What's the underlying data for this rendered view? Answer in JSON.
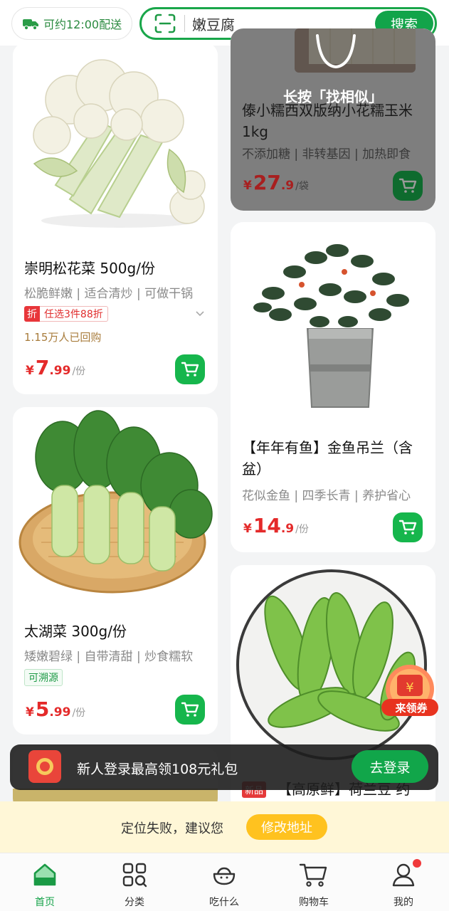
{
  "header": {
    "delivery_text": "可约12:00配送",
    "search_value": "嫩豆腐",
    "search_button": "搜索"
  },
  "products": [
    {
      "title": "崇明松花菜 500g/份",
      "desc": "松脆鲜嫩 | 适合清炒 | 可做干锅",
      "promo_badge": "折",
      "promo_text": "任选3件88折",
      "bought": "1.15万人已回购",
      "price_symbol": "¥",
      "price_int": "7",
      "price_dec": ".99",
      "unit": "/份"
    },
    {
      "title": "太湖菜 300g/份",
      "desc": "矮嫩碧绿 | 自带清甜 | 炒食糯软",
      "trace_tag": "可溯源",
      "price_symbol": "¥",
      "price_int": "5",
      "price_dec": ".99",
      "unit": "/份"
    },
    {
      "overlay_text": "长按「找相似」",
      "title": "傣小糯西双版纳小花糯玉米1kg",
      "desc": "不添加糖 | 非转基因 | 加热即食",
      "price_symbol": "¥",
      "price_int": "27",
      "price_dec": ".9",
      "unit": "/袋"
    },
    {
      "title": "【年年有鱼】金鱼吊兰（含盆）",
      "desc": "花似金鱼 | 四季长青 | 养护省心",
      "price_symbol": "¥",
      "price_int": "14",
      "price_dec": ".9",
      "unit": "/份"
    },
    {
      "new_badge": "新品",
      "title": "【高原鲜】荷兰豆 约"
    }
  ],
  "coupon_float": "来领券",
  "login_banner": {
    "text": "新人登录最高领108元礼包",
    "button": "去登录"
  },
  "location": {
    "message": "定位失败，建议您",
    "button": "修改地址"
  },
  "tabs": [
    {
      "label": "首页",
      "icon": "home-icon",
      "active": true
    },
    {
      "label": "分类",
      "icon": "category-icon"
    },
    {
      "label": "吃什么",
      "icon": "bowl-icon"
    },
    {
      "label": "购物车",
      "icon": "cart-icon"
    },
    {
      "label": "我的",
      "icon": "profile-icon"
    }
  ],
  "colors": {
    "brand_green": "#12a44a",
    "price_red": "#e42a2a",
    "location_button": "#ffc21f"
  }
}
